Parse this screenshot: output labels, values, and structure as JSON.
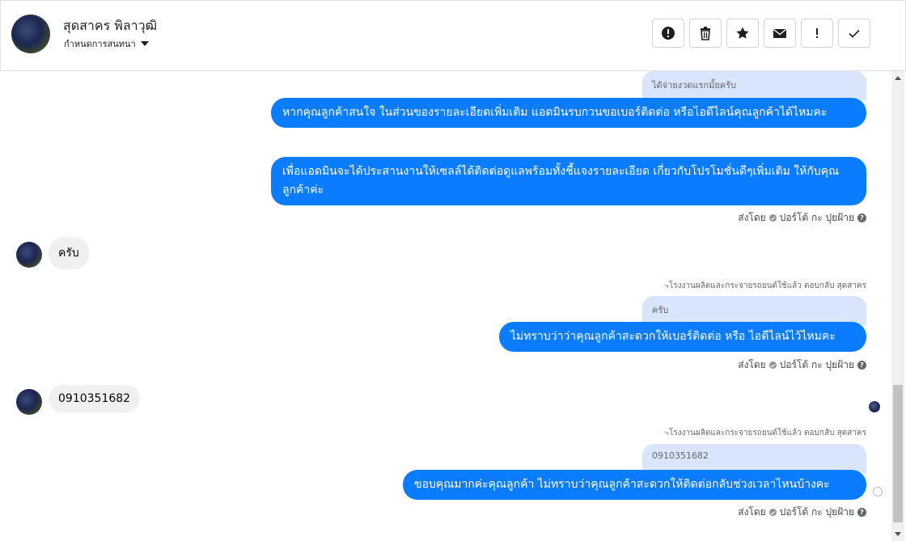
{
  "header": {
    "name": "สุดสาคร พิลาวุฒิ",
    "subtitle": "กำหนดการสนทนา"
  },
  "toolbar": {
    "buttons": [
      {
        "icon": "alert-circle-icon"
      },
      {
        "icon": "trash-icon"
      },
      {
        "icon": "star-icon"
      },
      {
        "icon": "envelope-icon"
      },
      {
        "icon": "exclamation-icon"
      },
      {
        "icon": "check-icon"
      }
    ]
  },
  "messages": {
    "quote1": "ได้จ่ายงวดแรกมั้ยครับ",
    "out1": "หากคุณลูกค้าสนใจ ในส่วนของรายละเอียดเพิ่มเติม แอดมินรบกวนขอเบอร์ติดต่อ หรือไอดีไลน์คุณลูกค้าได้ไหมคะ",
    "out2": "เพื่อแอดมินจะได้ประสานงานให้เซลล์ได้ติดต่อดูแลพร้อมทั้งชี้แจงรายละเอียด เกี่ยวกับโปรโมชั่นดีๆเพิ่มเติม ให้กับคุณลูกค้าค่ะ",
    "sent_by_prefix": "ส่งโดย",
    "sent_by_name": "ปอร์โต้ กะ ปุยฝ้าย",
    "in1": "ครับ",
    "replied_label": "โรงงานผลิตและกระจายรถยนต์ใช้แล้ว ตอบกลับ สุดสาคร",
    "quote2": "ครับ",
    "out3": "ไม่ทราบว่าว่าคุณลูกค้าสะดวกให้เบอร์ติดต่อ หรือ ไอดีไลน์ไว้ไหมคะ",
    "in2": "0910351682",
    "quote3": "0910351682",
    "out4": "ขอบคุณมากค่ะคุณลูกค้า ไม่ทราบว่าคุณลูกค้าสะดวกให้ติดต่อกลับช่วงเวลาไหนบ้างคะ"
  }
}
